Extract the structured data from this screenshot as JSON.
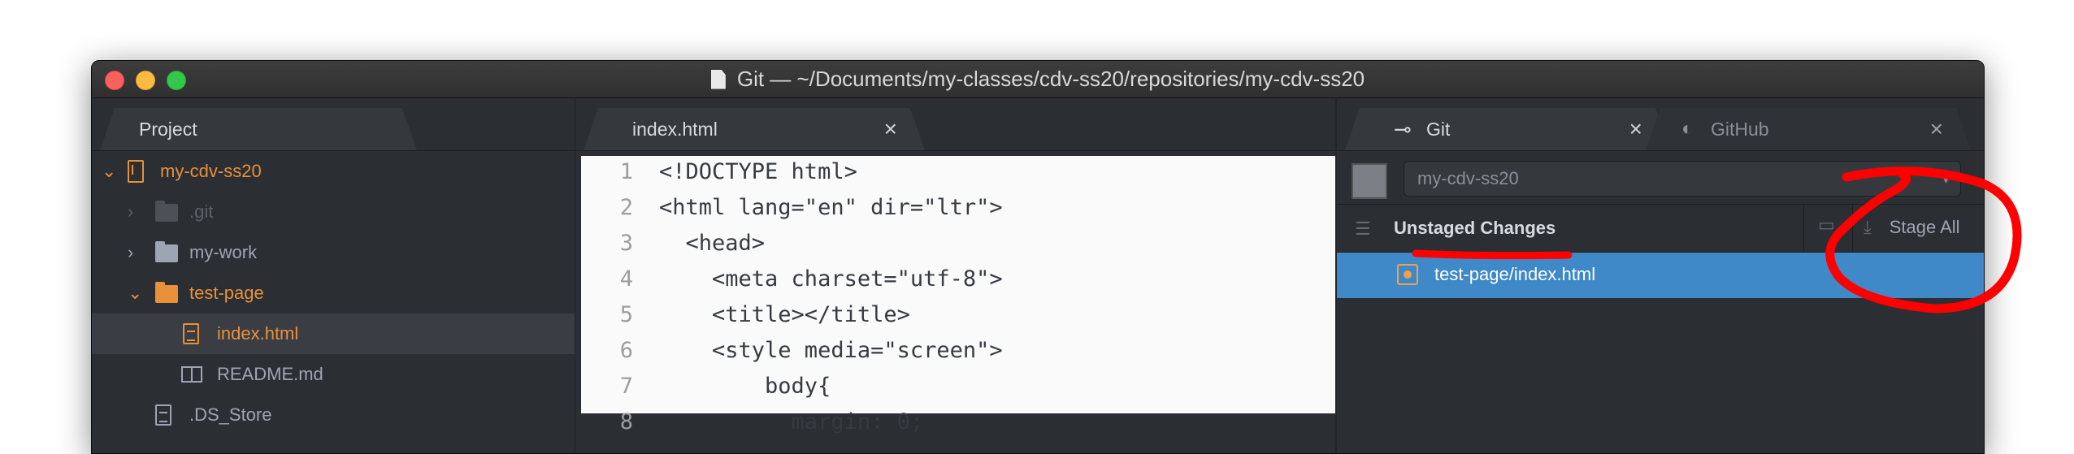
{
  "window": {
    "title": "Git — ~/Documents/my-classes/cdv-ss20/repositories/my-cdv-ss20"
  },
  "tree_panel": {
    "tab_label": "Project",
    "items": [
      {
        "label": "my-cdv-ss20",
        "kind": "repo",
        "state": "expanded"
      },
      {
        "label": ".git",
        "kind": "folder",
        "state": "collapsed"
      },
      {
        "label": "my-work",
        "kind": "folder",
        "state": "collapsed"
      },
      {
        "label": "test-page",
        "kind": "folder",
        "state": "expanded"
      },
      {
        "label": "index.html",
        "kind": "file",
        "selected": true
      },
      {
        "label": "README.md",
        "kind": "markdown"
      },
      {
        "label": ".DS_Store",
        "kind": "file"
      }
    ]
  },
  "editor": {
    "tab_label": "index.html",
    "line_numbers": [
      "1",
      "2",
      "3",
      "4",
      "5",
      "6",
      "7",
      "8"
    ],
    "lines": [
      "<!DOCTYPE html>",
      "<html lang=\"en\" dir=\"ltr\">",
      "  <head>",
      "    <meta charset=\"utf-8\">",
      "    <title></title>",
      "    <style media=\"screen\">",
      "        body{",
      "          margin: 0;"
    ]
  },
  "git_panel": {
    "tab_git": "Git",
    "tab_github": "GitHub",
    "branch": "my-cdv-ss20",
    "unstaged_label": "Unstaged Changes",
    "stage_all_label": "Stage All",
    "files": [
      {
        "path": "test-page/index.html",
        "status": "modified"
      }
    ]
  },
  "colors": {
    "accent_orange": "#e8913a",
    "selection_blue": "#3f89c9",
    "annotation_red": "#ff0000"
  }
}
